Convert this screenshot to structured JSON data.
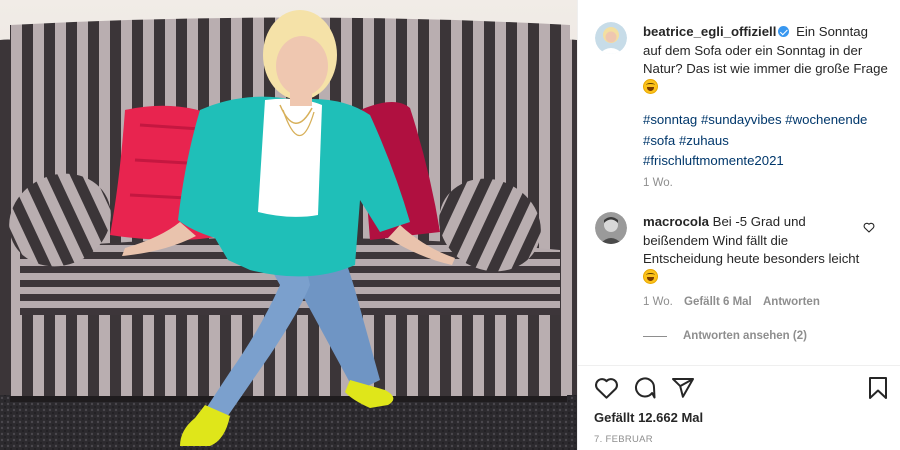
{
  "post": {
    "image_alt": "Woman in turquoise blazer and yellow heels sitting on a striped sofa with pink pillows"
  },
  "author": {
    "username": "beatrice_egli_offiziell",
    "verified": true,
    "caption_text": "Ein Sonntag auf dem Sofa oder ein Sonntag in der Natur? Das ist wie immer die große Frage",
    "caption_emoji": "rolling-on-the-floor-laughing-emoji",
    "hashtags": [
      "#sonntag",
      "#sundayvibes",
      "#wochenende",
      "#sofa",
      "#zuhaus",
      "#frischluftmomente2021"
    ],
    "time": "1 Wo."
  },
  "comment": {
    "username": "macrocola",
    "text": "Bei -5 Grad und beißendem Wind fällt die Entscheidung heute besonders leicht",
    "emoji": "grinning-sweat-emoji",
    "time": "1 Wo.",
    "likes": "Gefällt 6 Mal",
    "reply": "Antworten",
    "view_replies": "Antworten ansehen (2)"
  },
  "actions": {
    "like_icon": "heart-icon",
    "comment_icon": "comment-icon",
    "share_icon": "share-icon",
    "save_icon": "bookmark-icon"
  },
  "likes_text": "Gefällt 12.662 Mal",
  "date": "7. FEBRUAR",
  "colors": {
    "link": "#00376b",
    "muted": "#8e8e8e",
    "verified": "#3897f0",
    "blazer": "#1fbfb8",
    "pillow": "#e8244f",
    "shoes": "#dfe61a"
  }
}
